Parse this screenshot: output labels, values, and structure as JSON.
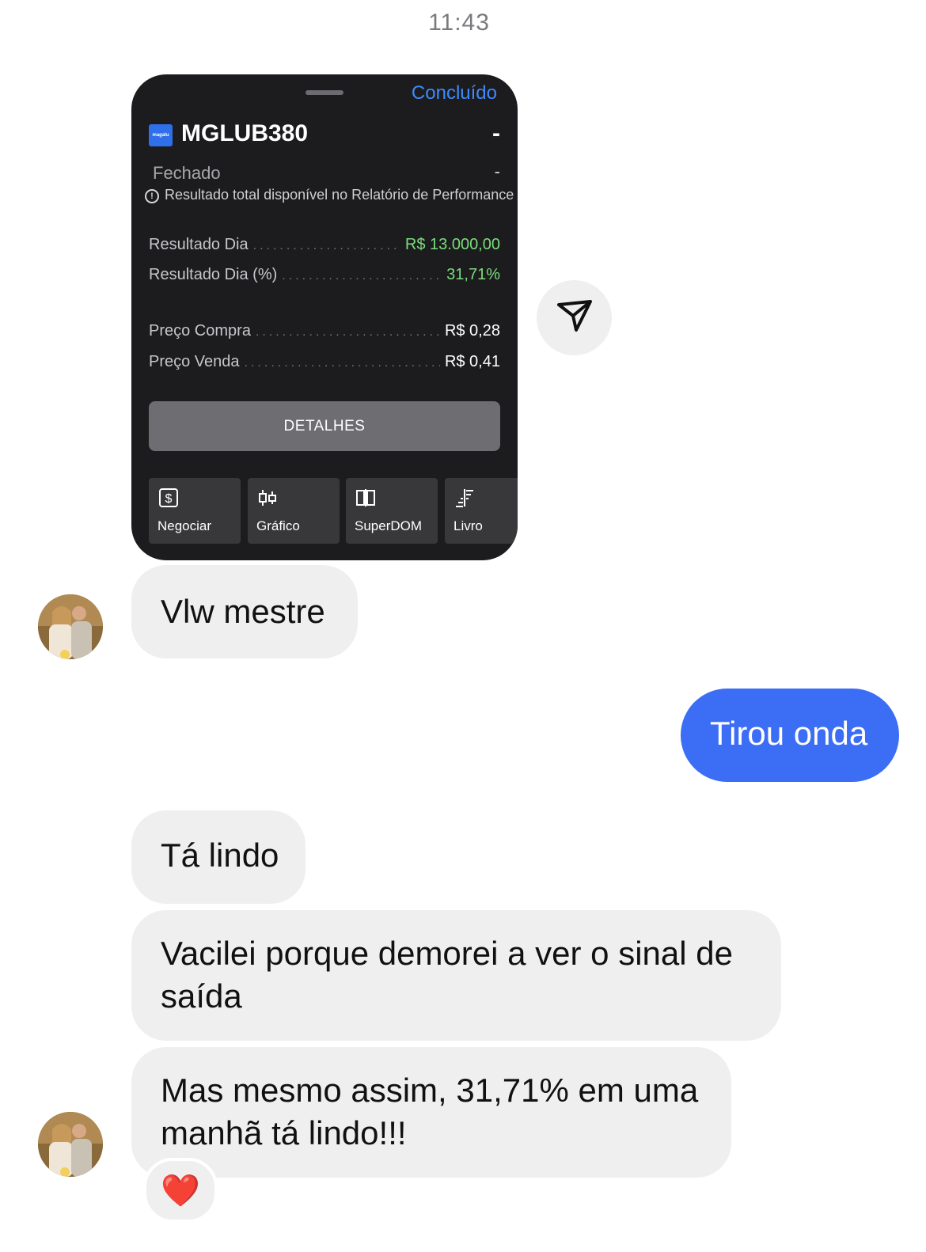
{
  "chat": {
    "timestamp": "11:43",
    "messages": [
      {
        "from": "them",
        "text": "Vlw mestre"
      },
      {
        "from": "me",
        "text": "Tirou onda"
      },
      {
        "from": "them",
        "text": "Tá lindo"
      },
      {
        "from": "them",
        "text": "Vacilei porque demorei a ver o sinal de saída"
      },
      {
        "from": "them",
        "text": "Mas mesmo assim, 31,71% em uma manhã tá lindo!!!"
      }
    ],
    "reaction": "❤️"
  },
  "card": {
    "done_label": "Concluído",
    "logo_text": "magalu",
    "ticker": "MGLUB380",
    "ticker_value": "-",
    "status": "Fechado",
    "status_value": "-",
    "info_text": "Resultado total disponível no Relatório de Performance",
    "rows": [
      {
        "label": "Resultado Dia",
        "value": "R$ 13.000,00"
      },
      {
        "label": "Resultado Dia (%)",
        "value": "31,71%"
      },
      {
        "label": "Preço Compra",
        "value": "R$ 0,28"
      },
      {
        "label": "Preço Venda",
        "value": "R$ 0,41"
      }
    ],
    "details_label": "DETALHES",
    "tiles": [
      {
        "label": "Negociar",
        "icon": "dollar-icon"
      },
      {
        "label": "Gráfico",
        "icon": "candlestick-icon"
      },
      {
        "label": "SuperDOM",
        "icon": "superdom-icon"
      },
      {
        "label": "Livro",
        "icon": "order-book-icon"
      }
    ],
    "colors": {
      "positive": "#7bdc7b",
      "accent": "#3d8bfd",
      "card_bg": "#1c1c1e"
    }
  },
  "colors": {
    "outgoing_bubble": "#3b6df5",
    "incoming_bubble": "#efefef"
  }
}
